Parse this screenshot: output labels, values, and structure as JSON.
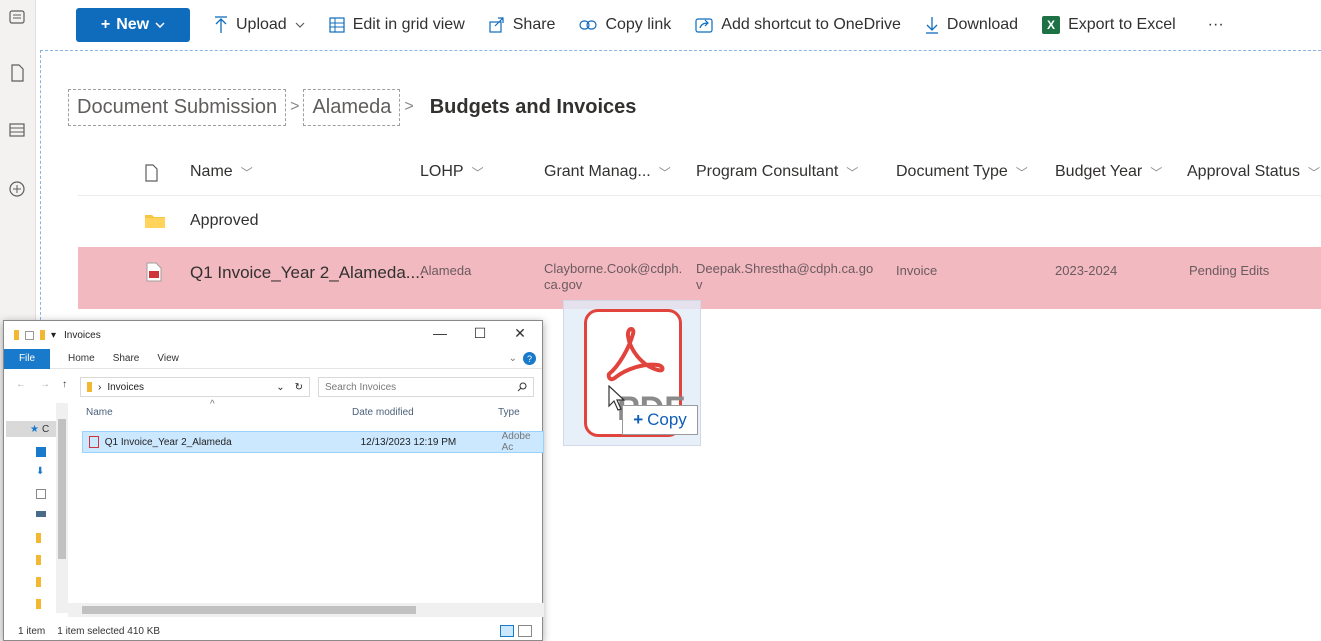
{
  "toolbar": {
    "new_label": "New",
    "upload_label": "Upload",
    "edit_grid_label": "Edit in grid view",
    "share_label": "Share",
    "copy_link_label": "Copy link",
    "shortcut_label": "Add shortcut to OneDrive",
    "download_label": "Download",
    "export_label": "Export to Excel",
    "more_label": "···",
    "excel_badge": "X"
  },
  "breadcrumb": {
    "items": [
      "Document Submission",
      "Alameda"
    ],
    "current": "Budgets and Invoices",
    "separator": ">"
  },
  "list": {
    "columns": [
      "Name",
      "LOHP",
      "Grant Manag...",
      "Program Consultant",
      "Document Type",
      "Budget Year",
      "Approval Status"
    ],
    "folder_row": {
      "name": "Approved"
    },
    "file_row": {
      "name": "Q1 Invoice_Year 2_Alameda....",
      "lohp": "Alameda",
      "grant_manager": "Clayborne.Cook@cdph.ca.gov",
      "program_consultant": "Deepak.Shrestha@cdph.ca.gov",
      "document_type": "Invoice",
      "budget_year": "2023-2024",
      "approval_status": "Pending Edits"
    }
  },
  "explorer": {
    "title": "Invoices",
    "ribbon_tabs": [
      "File",
      "Home",
      "Share",
      "View"
    ],
    "address": "Invoices",
    "search_placeholder": "Search Invoices",
    "columns": [
      "Name",
      "Date modified",
      "Type"
    ],
    "file": {
      "name": "Q1 Invoice_Year 2_Alameda",
      "date_modified": "12/13/2023 12:19 PM",
      "type": "Adobe Ac"
    },
    "status_items": "1 item",
    "status_selected": "1 item selected  410 KB",
    "quick_access": "C"
  },
  "drag": {
    "copy_label": "Copy",
    "pdf_letters": "PDF"
  },
  "colors": {
    "accent": "#0f6cbd",
    "selected_row": "#f2b9c0",
    "pdf_red": "#e0443c",
    "excel_green": "#1e7145"
  }
}
